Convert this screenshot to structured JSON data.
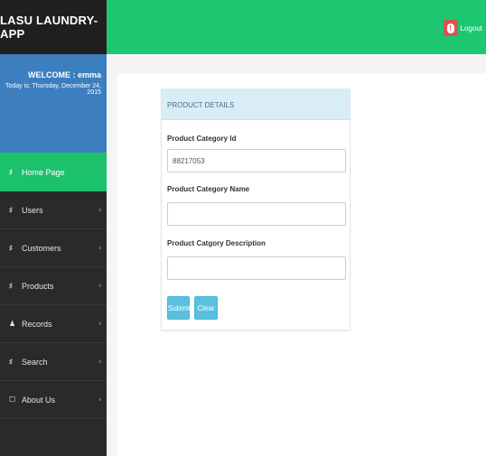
{
  "app": {
    "brand": "LASU LAUNDRY-APP"
  },
  "header": {
    "logout_label": "Logout",
    "logout_icon": "!"
  },
  "user": {
    "welcome": "WELCOME : emma",
    "today": "Today is: Thursday, December 24, 2015"
  },
  "sidebar": {
    "items": [
      {
        "label": "Home Page",
        "icon": "♯"
      },
      {
        "label": "Users",
        "icon": "♯"
      },
      {
        "label": "Customers",
        "icon": "♯"
      },
      {
        "label": "Products",
        "icon": "♯"
      },
      {
        "label": "Records",
        "icon": "♟"
      },
      {
        "label": "Search",
        "icon": "♯"
      },
      {
        "label": "About Us",
        "icon": "☐"
      }
    ],
    "caret": "‹"
  },
  "form": {
    "title": "PRODUCT DETAILS",
    "category_id_label": "Product Category Id",
    "category_id_value": "88217053",
    "category_name_label": "Product Category Name",
    "category_name_value": "",
    "category_desc_label": "Product Catgory Description",
    "category_desc_value": "",
    "submit_label": "Submit",
    "clear_label": "Clear"
  },
  "colors": {
    "sidebar_bg": "#2a2a2a",
    "brand_bg": "#1f1f1f",
    "welcome_bg": "#3d7ebf",
    "accent_green": "#1dc772",
    "panel_head_bg": "#d9edf7",
    "button_info": "#5bc0de",
    "logout_red": "#d9534f"
  }
}
